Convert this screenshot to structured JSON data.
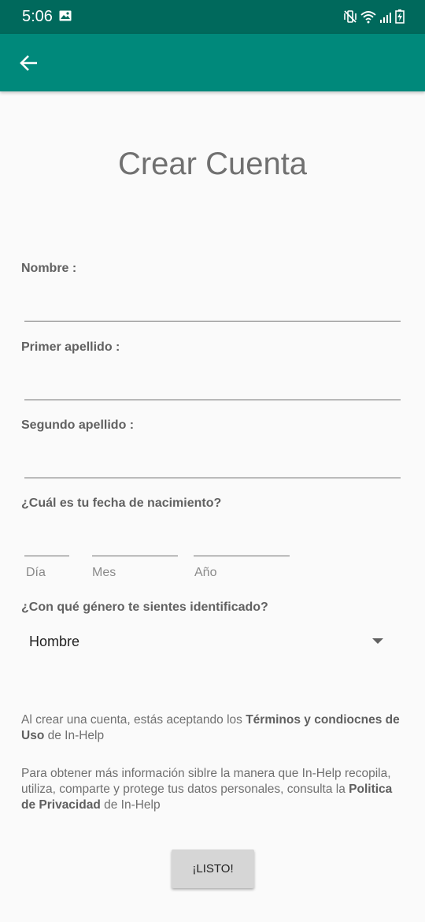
{
  "status_bar": {
    "time": "5:06",
    "icons": [
      "image-icon",
      "mute-vibrate-icon",
      "wifi-icon",
      "signal-icon",
      "battery-charging-icon"
    ]
  },
  "app_bar": {
    "back_icon": "arrow-back-icon",
    "color": "#00897b",
    "status_color": "#00695c"
  },
  "form": {
    "title": "Crear Cuenta",
    "nombre_label": "Nombre :",
    "primer_apellido_label": "Primer apellido :",
    "segundo_apellido_label": "Segundo apellido :",
    "fecha_label": "¿Cuál es tu fecha de nacimiento?",
    "dia_placeholder": "Día",
    "mes_placeholder": "Mes",
    "anio_placeholder": "Año",
    "genero_label": "¿Con qué género te sientes identificado?",
    "genero_value": "Hombre"
  },
  "legal": {
    "terms_prefix": "Al crear una cuenta, estás aceptando los ",
    "terms_link": "Términos y condiocnes de Uso",
    "terms_suffix": " de In-Help",
    "privacy_prefix": "Para obtener más información siblre la manera que In-Help recopila, utiliza, comparte y protege tus datos personales, consulta la ",
    "privacy_link": "Politica de Privacidad",
    "privacy_suffix": " de In-Help"
  },
  "submit_label": "¡LISTO!"
}
